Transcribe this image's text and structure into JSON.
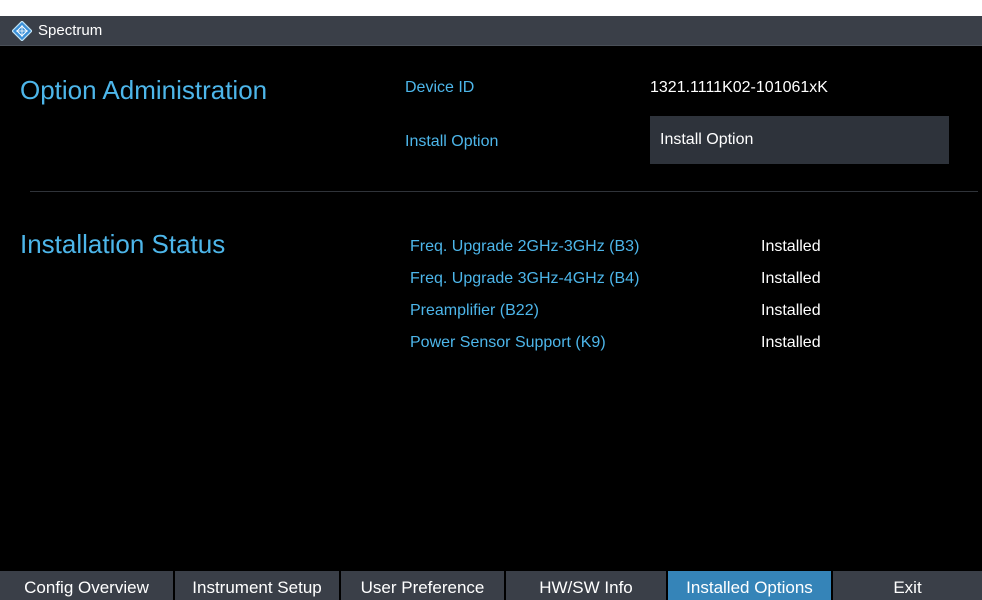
{
  "titlebar": {
    "app_title": "Spectrum"
  },
  "option_admin": {
    "title": "Option Administration",
    "device_id_label": "Device ID",
    "device_id_value": "1321.1111K02-101061xK",
    "install_option_label": "Install Option",
    "install_option_field": "Install Option"
  },
  "installation_status": {
    "title": "Installation Status",
    "items": [
      {
        "name": "Freq. Upgrade 2GHz-3GHz (B3)",
        "status": "Installed"
      },
      {
        "name": "Freq. Upgrade 3GHz-4GHz (B4)",
        "status": "Installed"
      },
      {
        "name": "Preamplifier (B22)",
        "status": "Installed"
      },
      {
        "name": "Power Sensor Support (K9)",
        "status": "Installed"
      }
    ]
  },
  "softkeys": [
    {
      "label": "Config Overview",
      "active": false
    },
    {
      "label": "Instrument Setup",
      "active": false
    },
    {
      "label": "User Preference",
      "active": false
    },
    {
      "label": "HW/SW Info",
      "active": false
    },
    {
      "label": "Installed Options",
      "active": true
    },
    {
      "label": "Exit",
      "active": false
    }
  ],
  "colors": {
    "accent": "#4db6ea",
    "active_softkey": "#3584b8",
    "softkey_bg": "#3a3f48",
    "background": "#000000"
  }
}
